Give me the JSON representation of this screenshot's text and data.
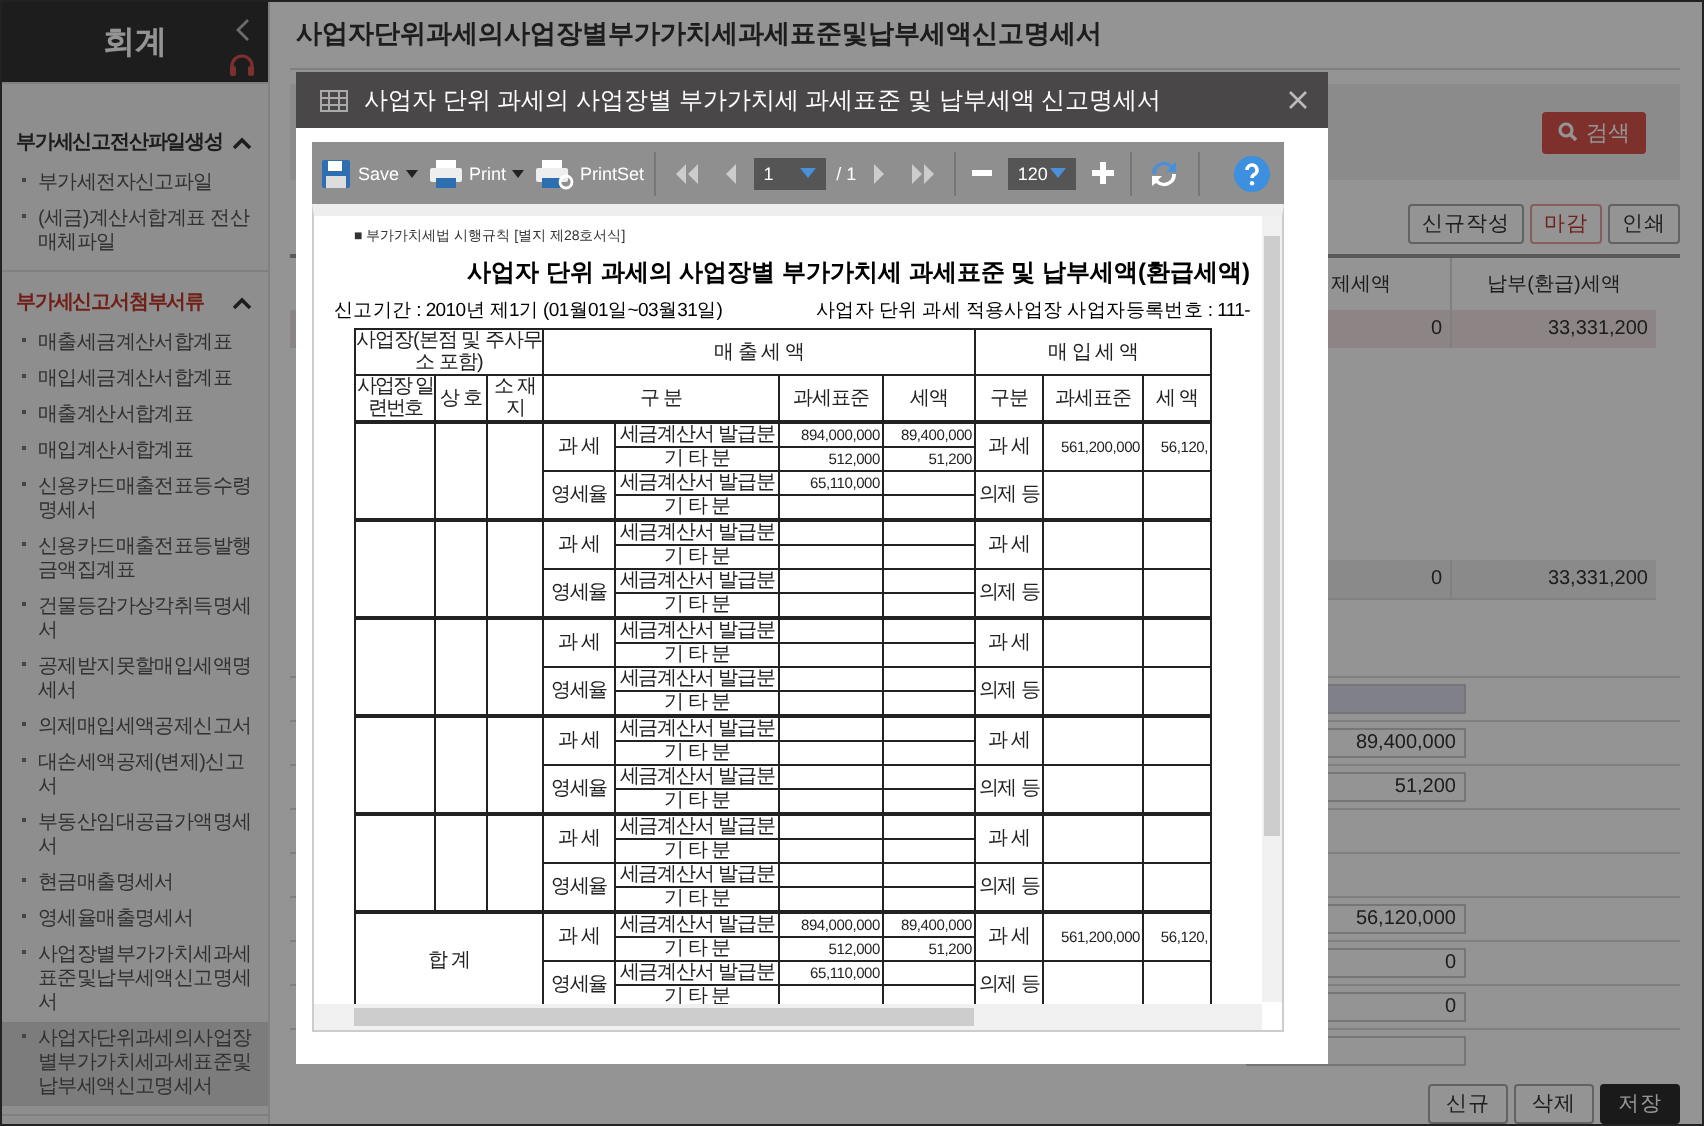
{
  "sidebar": {
    "title": "회계",
    "groups": [
      {
        "label": "부가세신고전산파일생성",
        "expanded": true,
        "selected": false,
        "items": [
          {
            "label": "부가세전자신고파일",
            "selected": false
          },
          {
            "label": "(세금)계산서합계표 전산매체파일",
            "selected": false
          }
        ]
      },
      {
        "label": "부가세신고서첨부서류",
        "expanded": true,
        "selected": true,
        "items": [
          {
            "label": "매출세금계산서합계표",
            "selected": false
          },
          {
            "label": "매입세금계산서합계표",
            "selected": false
          },
          {
            "label": "매출계산서합계표",
            "selected": false
          },
          {
            "label": "매입계산서합계표",
            "selected": false
          },
          {
            "label": "신용카드매출전표등수령명세서",
            "selected": false
          },
          {
            "label": "신용카드매출전표등발행금액집계표",
            "selected": false
          },
          {
            "label": "건물등감가상각취득명세서",
            "selected": false
          },
          {
            "label": "공제받지못할매입세액명세서",
            "selected": false
          },
          {
            "label": "의제매입세액공제신고서",
            "selected": false
          },
          {
            "label": "대손세액공제(변제)신고서",
            "selected": false
          },
          {
            "label": "부동산임대공급가액명세서",
            "selected": false
          },
          {
            "label": "현금매출명세서",
            "selected": false
          },
          {
            "label": "영세율매출명세서",
            "selected": false
          },
          {
            "label": "사업장별부가가치세과세표준및납부세액신고명세서",
            "selected": false
          },
          {
            "label": "사업자단위과세의사업장별부가가치세과세표준및납부세액신고명세서",
            "selected": true
          }
        ]
      }
    ]
  },
  "page": {
    "title": "사업자단위과세의사업장별부가가치세과세표준및납부세액신고명세서",
    "search_button": "검색",
    "actions": [
      {
        "label": "신규작성",
        "kind": "normal"
      },
      {
        "label": "마감",
        "kind": "accent"
      },
      {
        "label": "인쇄",
        "kind": "normal"
      }
    ],
    "summary": {
      "columns": [
        "제세액",
        "납부(환급)세액"
      ],
      "row": [
        "0",
        "33,331,200"
      ]
    },
    "totals_row": [
      "0",
      "33,331,200"
    ],
    "fields": [
      {
        "kind": "readonly"
      },
      {
        "kind": "input",
        "value": "89,400,000"
      },
      {
        "kind": "input",
        "value": "51,200"
      },
      {
        "kind": "none"
      },
      {
        "kind": "none"
      },
      {
        "kind": "input",
        "value": "56,120,000"
      },
      {
        "kind": "input",
        "value": "0"
      },
      {
        "kind": "input",
        "value": "0"
      },
      {
        "kind": "input"
      }
    ],
    "footer_buttons": [
      {
        "label": "신규",
        "kind": "normal"
      },
      {
        "label": "삭제",
        "kind": "normal"
      },
      {
        "label": "저장",
        "kind": "primary"
      }
    ]
  },
  "modal": {
    "title": "사업자 단위 과세의 사업장별 부가가치세 과세표준 및 납부세액 신고명세서",
    "toolbar": {
      "save": "Save",
      "print": "Print",
      "print_set": "PrintSet",
      "page": "1",
      "page_total": "/ 1",
      "zoom": "120"
    },
    "document": {
      "form_note": "■ 부가가치세법 시행규칙 [별지 제28호서식]",
      "title": "사업자 단위 과세의 사업장별 부가가치세 과세표준 및 납부세액(환급세액)",
      "period": "신고기간 : 2010년 제1기 (01월01일~03월31일)",
      "reg_no": "사업자 단위 과세 적용사업장 사업자등록번호 : 111-",
      "header": {
        "site": "사업장(본점 및 주사무소 포함)",
        "sales": "매 출 세 액",
        "purchase": "매 입 세 액",
        "serial": "사업장 일련번호",
        "name": "상 호",
        "address": "소 재 지",
        "sales_category": "구 분",
        "sales_base": "과세표준",
        "sales_tax": "세액",
        "purchase_category": "구분",
        "purchase_base": "과세표준",
        "purchase_tax": "세 액"
      },
      "groups": [
        {
          "sales": [
            {
              "category": "과 세",
              "lines": [
                {
                  "label": "세금계산서 발급분",
                  "base": "894,000,000",
                  "tax": "89,400,000"
                },
                {
                  "label": "기 타 분",
                  "base": "512,000",
                  "tax": "51,200"
                }
              ]
            },
            {
              "category": "영세율",
              "lines": [
                {
                  "label": "세금계산서 발급분",
                  "base": "65,110,000"
                },
                {
                  "label": "기 타 분"
                }
              ]
            }
          ],
          "purchases": [
            {
              "category": "과 세",
              "base": "561,200,000",
              "tax": "56,120,"
            },
            {
              "category": "의제 등"
            }
          ]
        },
        {
          "sales": [
            {
              "category": "과 세",
              "lines": [
                {
                  "label": "세금계산서 발급분"
                },
                {
                  "label": "기 타 분"
                }
              ]
            },
            {
              "category": "영세율",
              "lines": [
                {
                  "label": "세금계산서 발급분"
                },
                {
                  "label": "기 타 분"
                }
              ]
            }
          ],
          "purchases": [
            {
              "category": "과 세"
            },
            {
              "category": "의제 등"
            }
          ]
        },
        {
          "sales": [
            {
              "category": "과 세",
              "lines": [
                {
                  "label": "세금계산서 발급분"
                },
                {
                  "label": "기 타 분"
                }
              ]
            },
            {
              "category": "영세율",
              "lines": [
                {
                  "label": "세금계산서 발급분"
                },
                {
                  "label": "기 타 분"
                }
              ]
            }
          ],
          "purchases": [
            {
              "category": "과 세"
            },
            {
              "category": "의제 등"
            }
          ]
        },
        {
          "sales": [
            {
              "category": "과 세",
              "lines": [
                {
                  "label": "세금계산서 발급분"
                },
                {
                  "label": "기 타 분"
                }
              ]
            },
            {
              "category": "영세율",
              "lines": [
                {
                  "label": "세금계산서 발급분"
                },
                {
                  "label": "기 타 분"
                }
              ]
            }
          ],
          "purchases": [
            {
              "category": "과 세"
            },
            {
              "category": "의제 등"
            }
          ]
        },
        {
          "sales": [
            {
              "category": "과 세",
              "lines": [
                {
                  "label": "세금계산서 발급분"
                },
                {
                  "label": "기 타 분"
                }
              ]
            },
            {
              "category": "영세율",
              "lines": [
                {
                  "label": "세금계산서 발급분"
                },
                {
                  "label": "기 타 분"
                }
              ]
            }
          ],
          "purchases": [
            {
              "category": "과 세"
            },
            {
              "category": "의제 등"
            }
          ]
        }
      ],
      "total": {
        "label": "합 계",
        "sales": [
          {
            "category": "과 세",
            "lines": [
              {
                "label": "세금계산서 발급분",
                "base": "894,000,000",
                "tax": "89,400,000"
              },
              {
                "label": "기 타 분",
                "base": "512,000",
                "tax": "51,200"
              }
            ]
          },
          {
            "category": "영세율",
            "lines": [
              {
                "label": "세금계산서 발급분",
                "base": "65,110,000"
              },
              {
                "label": "기 타 분"
              }
            ]
          }
        ],
        "purchases": [
          {
            "category": "과 세",
            "base": "561,200,000",
            "tax": "56,120,"
          },
          {
            "category": "의제 등"
          }
        ]
      }
    }
  }
}
